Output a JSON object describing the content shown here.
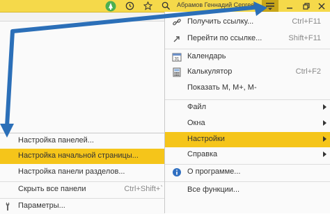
{
  "titlebar": {
    "user_name": "Абрамов Геннадий Сергеевич",
    "icons": [
      "bell-icon",
      "history-icon",
      "star-icon",
      "search-icon"
    ],
    "colors": {
      "bar": "#f5d94a",
      "menu_button": "#c8a618"
    }
  },
  "main_menu": {
    "items": [
      {
        "label": "Получить ссылку...",
        "shortcut": "Ctrl+F11",
        "icon": "link-icon"
      },
      {
        "label": "Перейти по ссылке...",
        "shortcut": "Shift+F11",
        "icon": "follow-link-icon"
      },
      {
        "label": "Календарь",
        "shortcut": "",
        "icon": "calendar-icon"
      },
      {
        "label": "Калькулятор",
        "shortcut": "Ctrl+F2",
        "icon": "calculator-icon"
      },
      {
        "label": "Показать M, M+, M-",
        "shortcut": "",
        "icon": ""
      },
      {
        "label": "Файл",
        "shortcut": "",
        "icon": ""
      },
      {
        "label": "Окна",
        "shortcut": "",
        "icon": ""
      },
      {
        "label": "Настройки",
        "shortcut": "",
        "icon": ""
      },
      {
        "label": "Справка",
        "shortcut": "",
        "icon": ""
      },
      {
        "label": "О программе...",
        "shortcut": "",
        "icon": "info-icon"
      },
      {
        "label": "Все функции...",
        "shortcut": "",
        "icon": ""
      }
    ],
    "active_color": "#f5c51a"
  },
  "settings_submenu": {
    "items": [
      {
        "label": "Настройка панелей...",
        "shortcut": ""
      },
      {
        "label": "Настройка начальной страницы...",
        "shortcut": ""
      },
      {
        "label": "Настройка панели разделов...",
        "shortcut": ""
      },
      {
        "label": "Скрыть все панели",
        "shortcut": "Ctrl+Shift+`"
      },
      {
        "label": "Параметры...",
        "shortcut": ""
      }
    ]
  }
}
